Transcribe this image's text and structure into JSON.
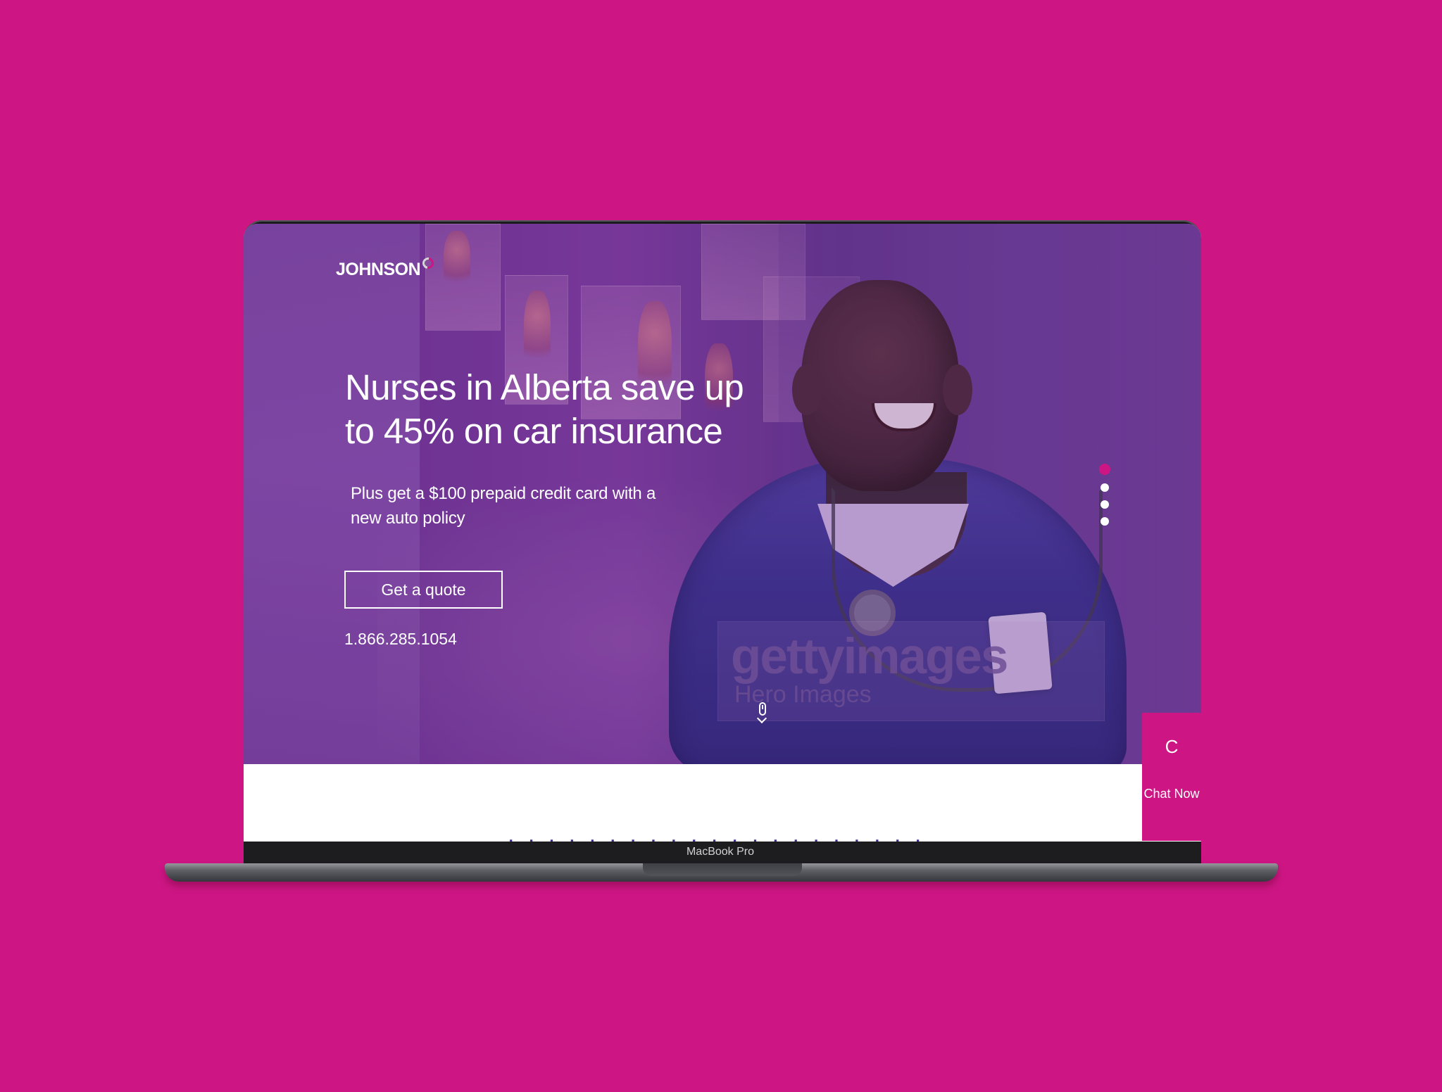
{
  "hero": {
    "logo_text": "JOHNSON",
    "title": "Nurses in Alberta save up to 45% on car insurance",
    "subtitle": "Plus get a $100 prepaid credit card with a new auto policy",
    "quote_button_label": "Get a quote",
    "phone": "1.866.285.1054",
    "carousel": {
      "active_index": 1,
      "total": 4
    },
    "watermark": {
      "main": "gettyimages",
      "sub": "Hero Images"
    }
  },
  "chat": {
    "icon": "C",
    "label": "Chat Now"
  },
  "device": {
    "label": "MacBook Pro"
  },
  "colors": {
    "background": "#cd1684",
    "accent": "#cd1684",
    "hero_tint": "#7b3d9d",
    "text": "#ffffff"
  },
  "icons": {
    "brand": "johnson-logo-icon",
    "scroll": "scroll-mouse-icon",
    "carousel": "carousel-dot-icon"
  }
}
